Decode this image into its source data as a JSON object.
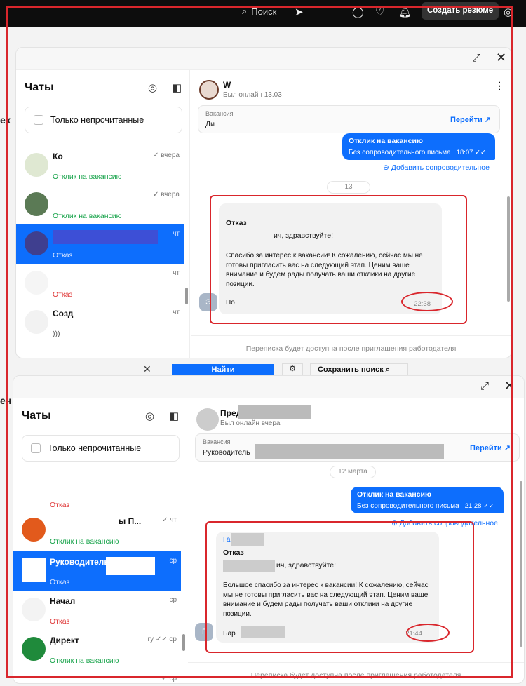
{
  "topbar": {
    "search_label": "Поиск",
    "resume_button": "Создать резюме"
  },
  "side_texts": {
    "upper": "ек",
    "lower": "ен"
  },
  "middle_bar": {
    "find": "Найти",
    "save_search": "Сохранить поиск"
  },
  "window1": {
    "left": {
      "title": "Чаты",
      "unread_label": "Только непрочитанные",
      "items": [
        {
          "title": "Ко",
          "date": "✓ вчера",
          "status": "Отклик на вакансию",
          "status_color": "green"
        },
        {
          "title": "",
          "date": "✓ вчера",
          "status": "Отклик на вакансию",
          "status_color": "green"
        },
        {
          "title": "",
          "date": "чт",
          "status": "Отказ",
          "status_color": "selected"
        },
        {
          "title": "",
          "date": "чт",
          "status": "Отказ",
          "status_color": "red"
        },
        {
          "title": "Созд",
          "date": "чт",
          "status": ")))",
          "status_color": "gray"
        }
      ]
    },
    "right": {
      "name": "W",
      "online": "Был онлайн 13.03",
      "vacancy_label": "Вакансия",
      "vacancy_name": "Ди",
      "vacancy_go": "Перейти ↗",
      "date_pill": "13",
      "blue_title": "Отклик на вакансию",
      "blue_sub": "Без сопроводительного письма",
      "blue_time": "18:07 ✓✓",
      "add_cover": "⊕ Добавить сопроводительное",
      "msg_title": "Отказ",
      "msg_greet": "ич, здравствуйте!",
      "msg_text": "Спасибо за интерес к вакансии! К сожалению, сейчас мы не готовы пригласить вас на следующий этап. Ценим ваше внимание и будем рады получать ваши отклики на другие позиции.",
      "msg_sign": "По",
      "msg_time": "22:38",
      "avatar_letter": "Э",
      "footer": "Переписка будет доступна после приглашения работодателя"
    }
  },
  "window2": {
    "left": {
      "title": "Чаты",
      "unread_label": "Только непрочитанные",
      "items": [
        {
          "title": "",
          "date": "",
          "status": "Отказ",
          "status_color": "red"
        },
        {
          "title": "ы П...",
          "date": "✓ чт",
          "status": "Отклик на вакансию",
          "status_color": "green"
        },
        {
          "title": "Руководитель",
          "date": "ср",
          "status": "Отказ",
          "status_color": "selected"
        },
        {
          "title": "Начал",
          "date": "ср",
          "status": "Отказ",
          "status_color": "red"
        },
        {
          "title": "Директ",
          "date": "гу ✓✓ ср",
          "status": "Отклик на вакансию",
          "status_color": "green"
        },
        {
          "title": "",
          "date": "✓ ср",
          "status": "",
          "status_color": "gray"
        }
      ]
    },
    "right": {
      "name": "Пред",
      "online": "Был онлайн вчера",
      "vacancy_label": "Вакансия",
      "vacancy_name": "Руководитель",
      "vacancy_go": "Перейти ↗",
      "date_pill": "12 марта",
      "blue_title": "Отклик на вакансию",
      "blue_sub": "Без сопроводительного письма",
      "blue_time": "21:28 ✓✓",
      "add_cover": "⊕ Добавить сопроводительное",
      "msg_head": "Га",
      "msg_title": "Отказ",
      "msg_greet": "ич, здравствуйте!",
      "msg_text": "Большое спасибо за интерес к вакансии! К сожалению, сейчас мы не готовы пригласить вас на следующий этап. Ценим ваше внимание и будем рады получать ваши отклики на другие позиции.",
      "msg_sign": "Бар",
      "msg_time": "21:44",
      "avatar_letter": "Г",
      "footer": "Переписка будет доступна после приглашения работодателя"
    }
  }
}
